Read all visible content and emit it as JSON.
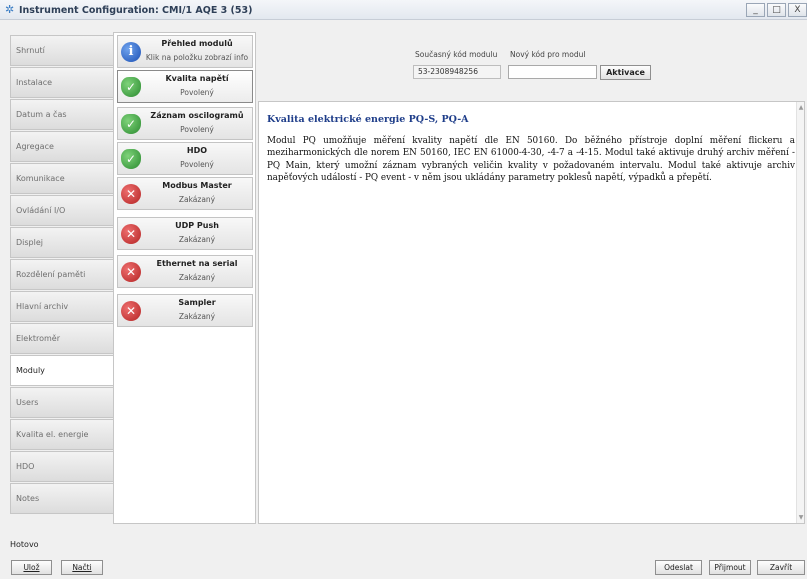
{
  "window": {
    "title": "Instrument Configuration: CMI/1    AQE 3 (53)",
    "controls": [
      "_",
      "□",
      "X"
    ]
  },
  "tabs": [
    {
      "label": "Shrnutí"
    },
    {
      "label": "Instalace"
    },
    {
      "label": "Datum a čas"
    },
    {
      "label": "Agregace"
    },
    {
      "label": "Komunikace"
    },
    {
      "label": "Ovládání I/O"
    },
    {
      "label": "Displej"
    },
    {
      "label": "Rozdělení paměti"
    },
    {
      "label": "Hlavní archiv"
    },
    {
      "label": "Elektroměr"
    },
    {
      "label": "Moduly"
    },
    {
      "label": "Users"
    },
    {
      "label": "Kvalita el. energie"
    },
    {
      "label": "HDO"
    },
    {
      "label": "Notes"
    }
  ],
  "active_tab": "Moduly",
  "modules": [
    {
      "name": "Přehled modulů",
      "status": "Klik na položku zobrazí info",
      "icon": "info-icon"
    },
    {
      "name": "Kvalita napětí",
      "status": "Povolený",
      "icon": "shield-check-icon"
    },
    {
      "name": "Záznam oscilogramů",
      "status": "Povolený",
      "icon": "shield-check-icon"
    },
    {
      "name": "HDO",
      "status": "Povolený",
      "icon": "shield-check-icon"
    },
    {
      "name": "Modbus Master",
      "status": "Zakázaný",
      "icon": "error-x-icon"
    },
    {
      "name": "UDP Push",
      "status": "Zakázaný",
      "icon": "error-x-icon"
    },
    {
      "name": "Ethernet na serial",
      "status": "Zakázaný",
      "icon": "error-x-icon"
    },
    {
      "name": "Sampler",
      "status": "Zakázaný",
      "icon": "error-x-icon"
    }
  ],
  "selected_module": "Kvalita napětí",
  "code": {
    "current_label": "Současný kód modulu",
    "new_label": "Nový kód pro modul",
    "current_value": "53-2308948256",
    "new_value": "",
    "activate_label": "Aktivace"
  },
  "info": {
    "heading": "Kvalita elektrické energie PQ-S, PQ-A",
    "text": "Modul PQ umožňuje měření kvality napětí dle EN 50160. Do běžného přístroje doplní měření flickeru a meziharmonických dle norem EN 50160, IEC EN 61000-4-30, -4-7 a -4-15. Modul také aktivuje druhý archiv měření - PQ Main, který umožní záznam vybraných veličin kvality v požadovaném intervalu. Modul také aktivuje archiv napěťových událostí - PQ event - v něm jsou ukládány parametry poklesů napětí, výpadků a přepětí."
  },
  "status_text": "Hotovo",
  "buttons": {
    "save": "Ulož",
    "load": "Načti",
    "send": "Odeslat",
    "receive": "Přijmout",
    "close": "Zavřít"
  }
}
